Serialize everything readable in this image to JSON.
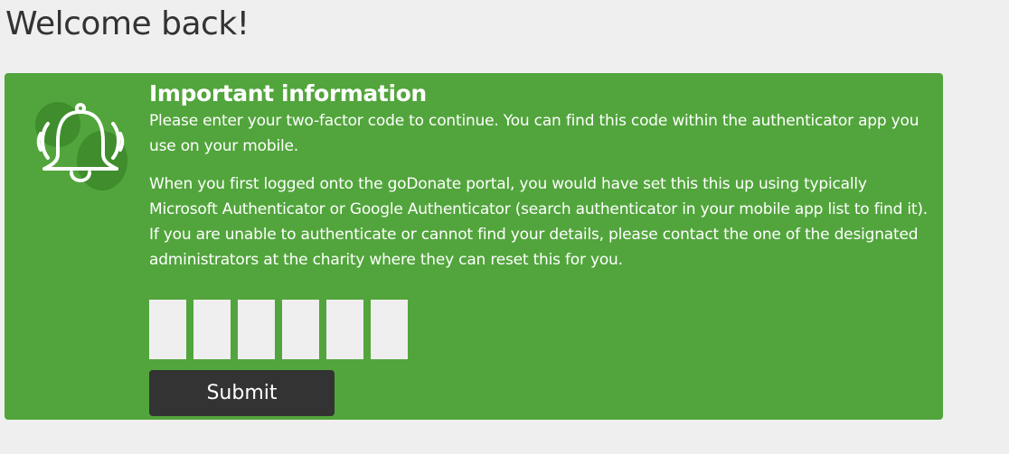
{
  "page": {
    "heading": "Welcome back!"
  },
  "notice": {
    "icon": "bell-ringing-icon",
    "title": "Important information",
    "paragraph1": "Please enter your two-factor code to continue. You can find this code within the authenticator app you use on your mobile.",
    "paragraph2": "When you first logged onto the goDonate portal, you would have set this this up using typically Microsoft Authenticator or Google Authenticator (search authenticator in your mobile app list to find it). If you are unable to authenticate or cannot find your details, please contact the one of the designated administrators at the charity where they can reset this for you."
  },
  "code_inputs": {
    "digits": [
      "",
      "",
      "",
      "",
      "",
      ""
    ]
  },
  "submit": {
    "label": "Submit"
  },
  "colors": {
    "page_background": "#efefef",
    "panel_background": "#52a53c",
    "button_background": "#333333",
    "input_background": "#efefef"
  }
}
